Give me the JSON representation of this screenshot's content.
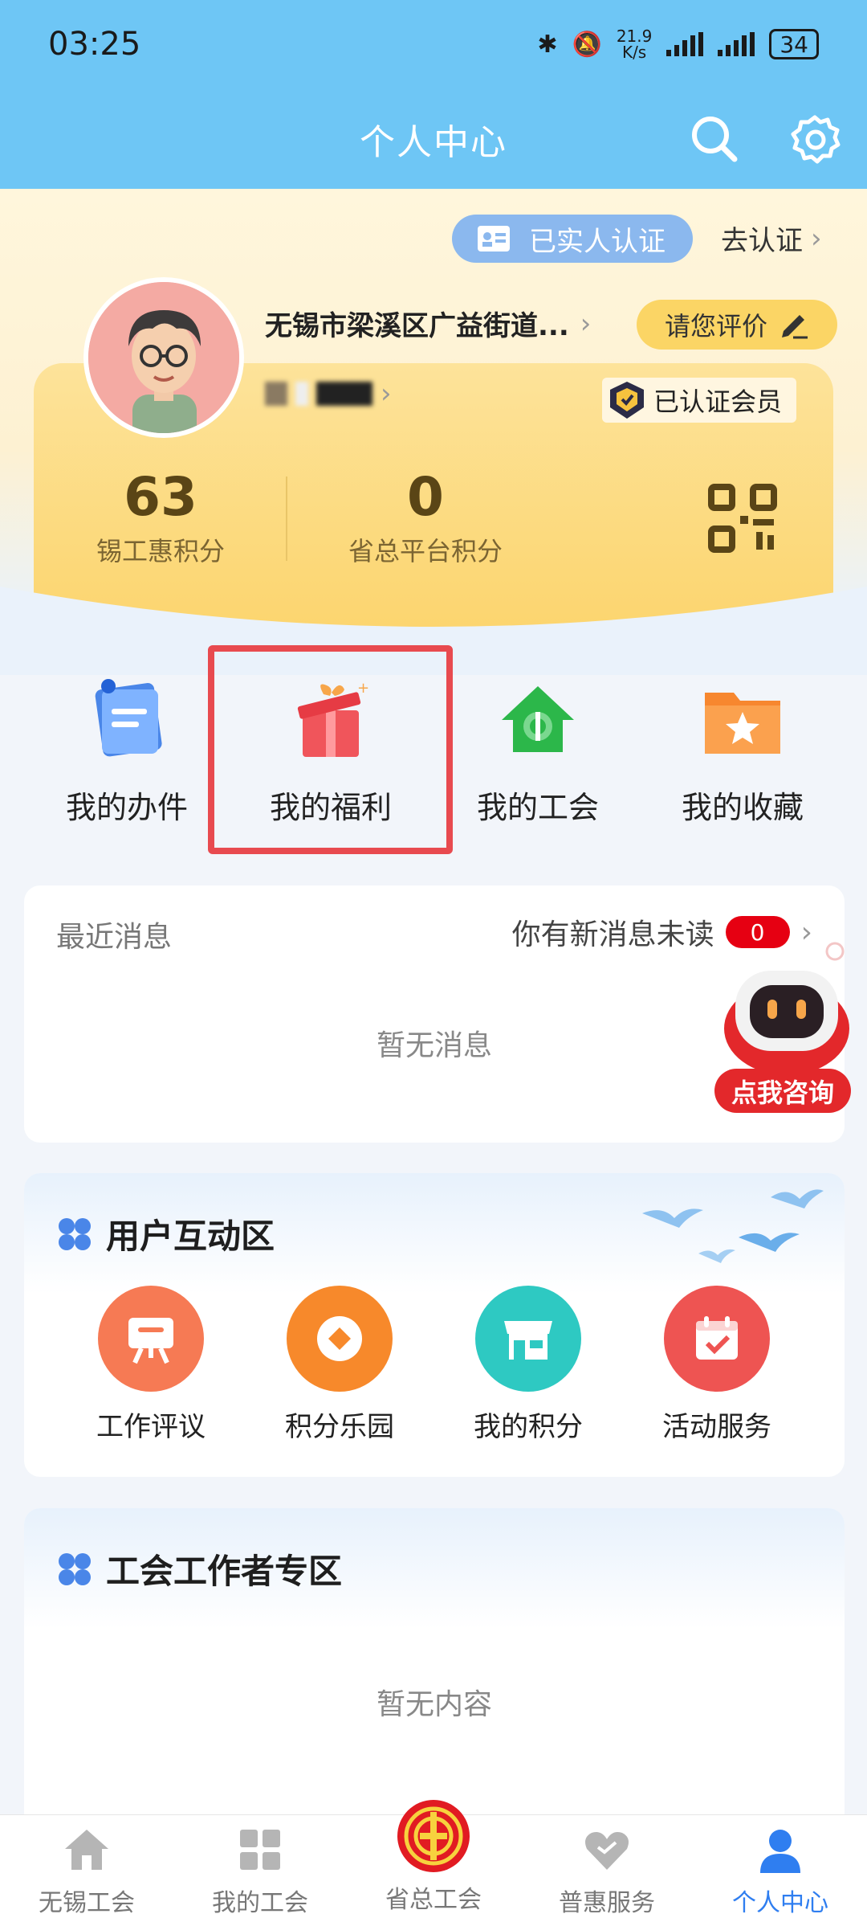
{
  "status_bar": {
    "time": "03:25",
    "speed": "21.9\nK/s",
    "battery": "34"
  },
  "app_bar": {
    "title": "个人中心"
  },
  "profile": {
    "verified_label": "已实人认证",
    "go_verify_label": "去认证",
    "org_name": "无锡市梁溪区广益街道...",
    "evaluate_label": "请您评价",
    "member_badge": "已认证会员",
    "scores": [
      {
        "value": "63",
        "label": "锡工惠积分"
      },
      {
        "value": "0",
        "label": "省总平台积分"
      }
    ]
  },
  "quick_actions": [
    {
      "label": "我的办件",
      "icon": "document-icon"
    },
    {
      "label": "我的福利",
      "icon": "gift-icon"
    },
    {
      "label": "我的工会",
      "icon": "union-home-icon"
    },
    {
      "label": "我的收藏",
      "icon": "star-folder-icon"
    }
  ],
  "messages": {
    "title": "最近消息",
    "unread_text": "你有新消息未读",
    "unread_count": "0",
    "empty_text": "暂无消息"
  },
  "consult": {
    "label": "点我咨询"
  },
  "interaction": {
    "title": "用户互动区",
    "items": [
      {
        "label": "工作评议",
        "icon": "easel-icon",
        "color": "#f67a54"
      },
      {
        "label": "积分乐园",
        "icon": "coin-icon",
        "color": "#f7892b"
      },
      {
        "label": "我的积分",
        "icon": "shop-icon",
        "color": "#2ec9c2"
      },
      {
        "label": "活动服务",
        "icon": "calendar-icon",
        "color": "#ee5452"
      }
    ]
  },
  "workers": {
    "title": "工会工作者专区",
    "empty_text": "暂无内容"
  },
  "bottom_nav": [
    {
      "label": "无锡工会",
      "icon": "home-icon"
    },
    {
      "label": "我的工会",
      "icon": "grid-icon"
    },
    {
      "label": "省总工会",
      "icon": "union-emblem-icon"
    },
    {
      "label": "普惠服务",
      "icon": "heart-icon"
    },
    {
      "label": "个人中心",
      "icon": "person-icon"
    }
  ],
  "colors": {
    "header": "#6ec6f5",
    "accent": "#2f7ef0",
    "highlight": "#e84a4f"
  }
}
